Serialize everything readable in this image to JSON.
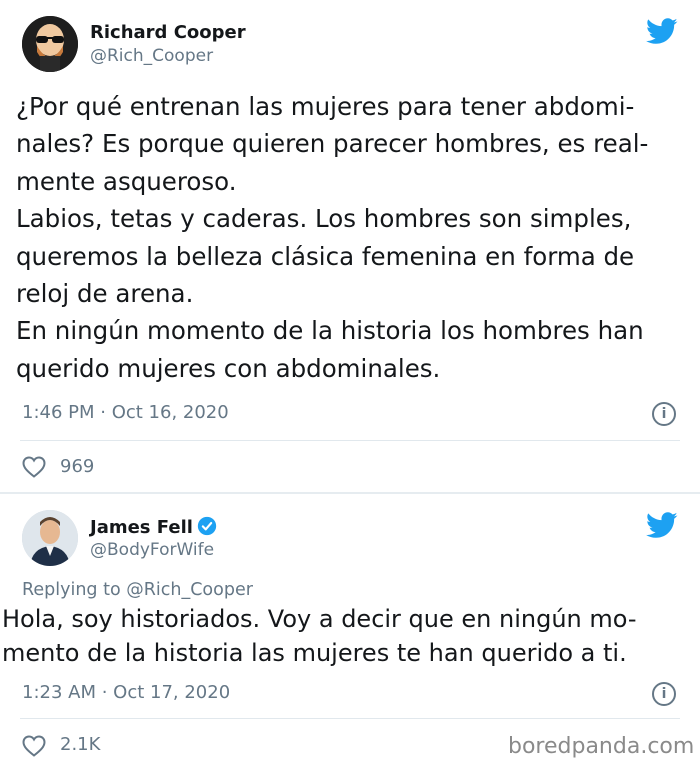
{
  "tweet1": {
    "name": "Richard Cooper",
    "handle": "@Rich_Cooper",
    "text": "¿Por qué entrenan las mujeres para tener abdomi-\nnales? Es porque quieren parecer hombres, es real-\nmente asqueroso.\nLabios, tetas y caderas. Los hombres son simples,\nqueremos la belleza clásica femenina en forma de\nreloj de arena.\nEn ningún momento de la historia los hombres han\nquerido mujeres con abdominales.",
    "timestamp": "1:46 PM · Oct 16, 2020",
    "likes": "969",
    "avatar_icon": "bald-man-sunglasses-avatar",
    "platform_icon": "twitter-bird-icon"
  },
  "tweet2": {
    "name": "James Fell",
    "handle": "@BodyForWife",
    "verified": true,
    "replying_to": "Replying to @Rich_Cooper",
    "text": "Hola, soy historiados. Voy a decir que en ningún mo-\nmento de la historia las mujeres te han querido a ti.",
    "timestamp": "1:23 AM · Oct 17, 2020",
    "likes": "2.1K",
    "avatar_icon": "man-photo-avatar",
    "platform_icon": "twitter-bird-icon"
  },
  "watermark": "boredpanda.com",
  "colors": {
    "twitter_blue": "#1da1f2",
    "secondary_text": "#657786"
  }
}
